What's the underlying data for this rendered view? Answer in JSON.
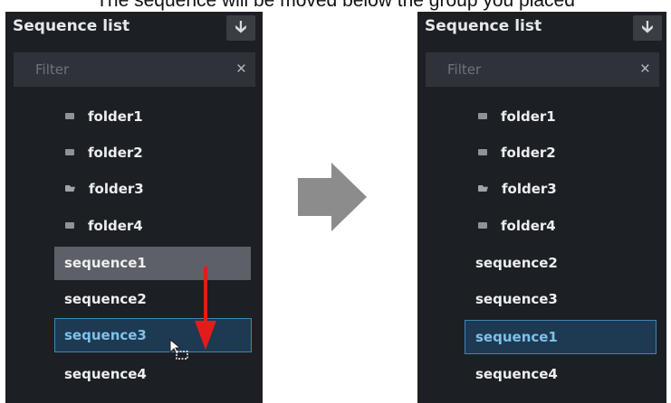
{
  "caption": "The sequence will be moved below the group you placed",
  "colors": {
    "panel_bg": "#1c1f24",
    "filter_bg": "#2f3339",
    "drag_source_bg": "#5d6066",
    "selected_bg": "#1d3a52",
    "selected_border": "#3d87b8",
    "selected_text": "#7fc0e8",
    "drag_arrow": "#e31b1b",
    "transition_arrow": "#8c8c8c"
  },
  "left_panel": {
    "title": "Sequence list",
    "download_icon": "arrow-down-icon",
    "filter_placeholder": "Filter",
    "clear_icon": "×",
    "folders": [
      "folder1",
      "folder2",
      "folder3",
      "folder4"
    ],
    "sequences": [
      "sequence1",
      "sequence2",
      "sequence3",
      "sequence4"
    ]
  },
  "right_panel": {
    "title": "Sequence list",
    "download_icon": "arrow-down-icon",
    "filter_placeholder": "Filter",
    "clear_icon": "×",
    "folders": [
      "folder1",
      "folder2",
      "folder3",
      "folder4"
    ],
    "sequences": [
      "sequence2",
      "sequence3",
      "sequence1",
      "sequence4"
    ]
  },
  "icons": {
    "folder": "folder-icon",
    "open_folder": "folder-open-icon",
    "drag_arrow": "drag-arrow-down-icon",
    "cursor": "drag-cursor-icon",
    "transition": "right-arrow-icon"
  }
}
